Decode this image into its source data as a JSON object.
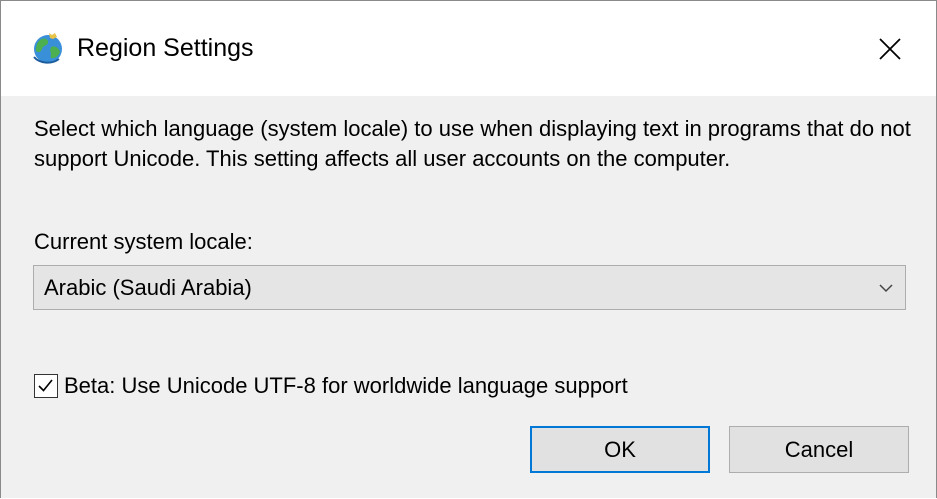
{
  "window": {
    "title": "Region Settings",
    "icon": "globe-icon",
    "close_icon": "close-icon"
  },
  "content": {
    "description": "Select which language (system locale) to use when displaying text in programs that do not support Unicode. This setting affects all user accounts on the computer.",
    "locale_label": "Current system locale:",
    "locale_value": "Arabic (Saudi Arabia)",
    "beta_label": "Beta: Use Unicode UTF-8 for worldwide language support",
    "beta_checked": true
  },
  "buttons": {
    "ok": "OK",
    "cancel": "Cancel"
  },
  "colors": {
    "accent": "#0078d7",
    "dialog_bg": "#f0f0f0",
    "title_bg": "#ffffff"
  }
}
